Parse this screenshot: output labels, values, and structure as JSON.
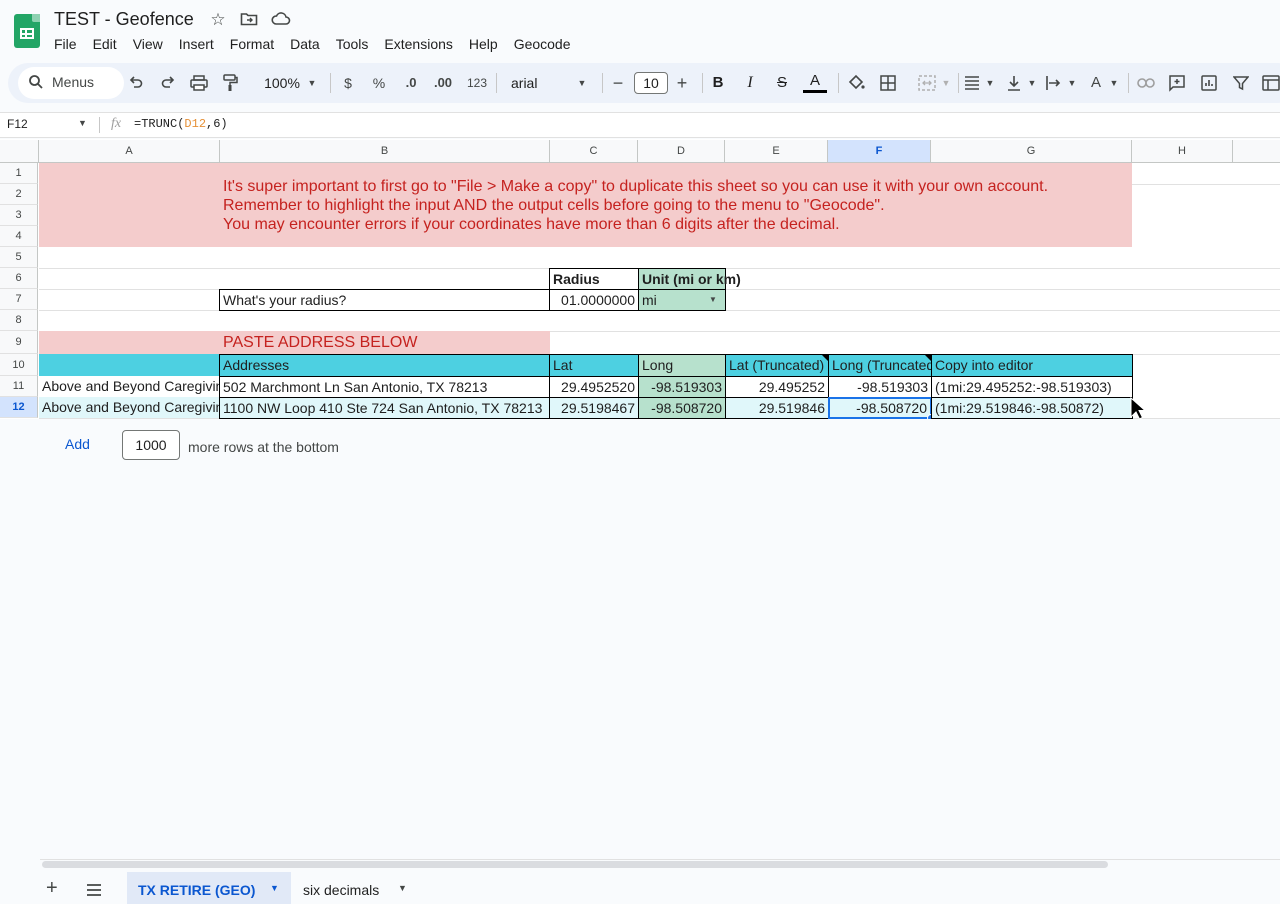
{
  "app": {
    "doc_title": "TEST - Geofence",
    "menus": [
      "File",
      "Edit",
      "View",
      "Insert",
      "Format",
      "Data",
      "Tools",
      "Extensions",
      "Help",
      "Geocode"
    ]
  },
  "toolbar": {
    "search_label": "Menus",
    "zoom": "100%",
    "currency": "$",
    "percent": "%",
    "dec_less": ".0",
    "dec_more": ".00",
    "number_format": "123",
    "font": "arial",
    "font_size": "10",
    "minus": "−",
    "plus": "+",
    "bold": "B",
    "italic": "I",
    "strike": "S",
    "textcolor": "A"
  },
  "formula_bar": {
    "name_box": "F12",
    "fx": "fx",
    "formula_prefix": "=TRUNC(",
    "formula_ref": "D12",
    "formula_suffix": ",6)"
  },
  "columns": [
    "A",
    "B",
    "C",
    "D",
    "E",
    "F",
    "G",
    "H"
  ],
  "rows": [
    "1",
    "2",
    "3",
    "4",
    "5",
    "6",
    "7",
    "8",
    "9",
    "10",
    "11",
    "12"
  ],
  "banner": {
    "line1": "It's super important to first go to \"File > Make a copy\" to duplicate this sheet so you can use it with your own account.",
    "line2": "Remember to highlight the input AND the output cells before going to the menu to \"Geocode\".",
    "line3": "You may encounter errors if your coordinates have more than 6 digits after the decimal."
  },
  "radius": {
    "header_radius": "Radius",
    "header_unit": "Unit (mi or km)",
    "question": "What's your radius?",
    "value": "01.0000000",
    "unit": "mi"
  },
  "paste_label": "PASTE ADDRESS BELOW",
  "table": {
    "headers": [
      "",
      "Addresses",
      "Lat",
      "Long",
      "Lat (Truncated)",
      "Long (Truncated)",
      "Copy into editor"
    ],
    "rows": [
      [
        "Above and Beyond Caregiving",
        "502 Marchmont Ln San Antonio, TX 78213",
        "29.4952520",
        "-98.519303",
        "29.495252",
        "-98.519303",
        "(1mi:29.495252:-98.519303)"
      ],
      [
        "Above and Beyond Caregiving",
        "1100 NW Loop 410 Ste 724 San Antonio, TX 78213",
        "29.5198467",
        "-98.508720",
        "29.519846",
        "-98.508720",
        "(1mi:29.519846:-98.50872)"
      ]
    ]
  },
  "add_rows": {
    "button": "Add",
    "count": "1000",
    "suffix": "more rows at the bottom"
  },
  "sheets": {
    "add": "+",
    "tabs": [
      "TX RETIRE (GEO)",
      "six decimals"
    ]
  },
  "colors": {
    "teal": "#4dd0e1",
    "green": "#b7e1cd",
    "pink": "#f4cccc",
    "selection": "#1a73e8"
  }
}
